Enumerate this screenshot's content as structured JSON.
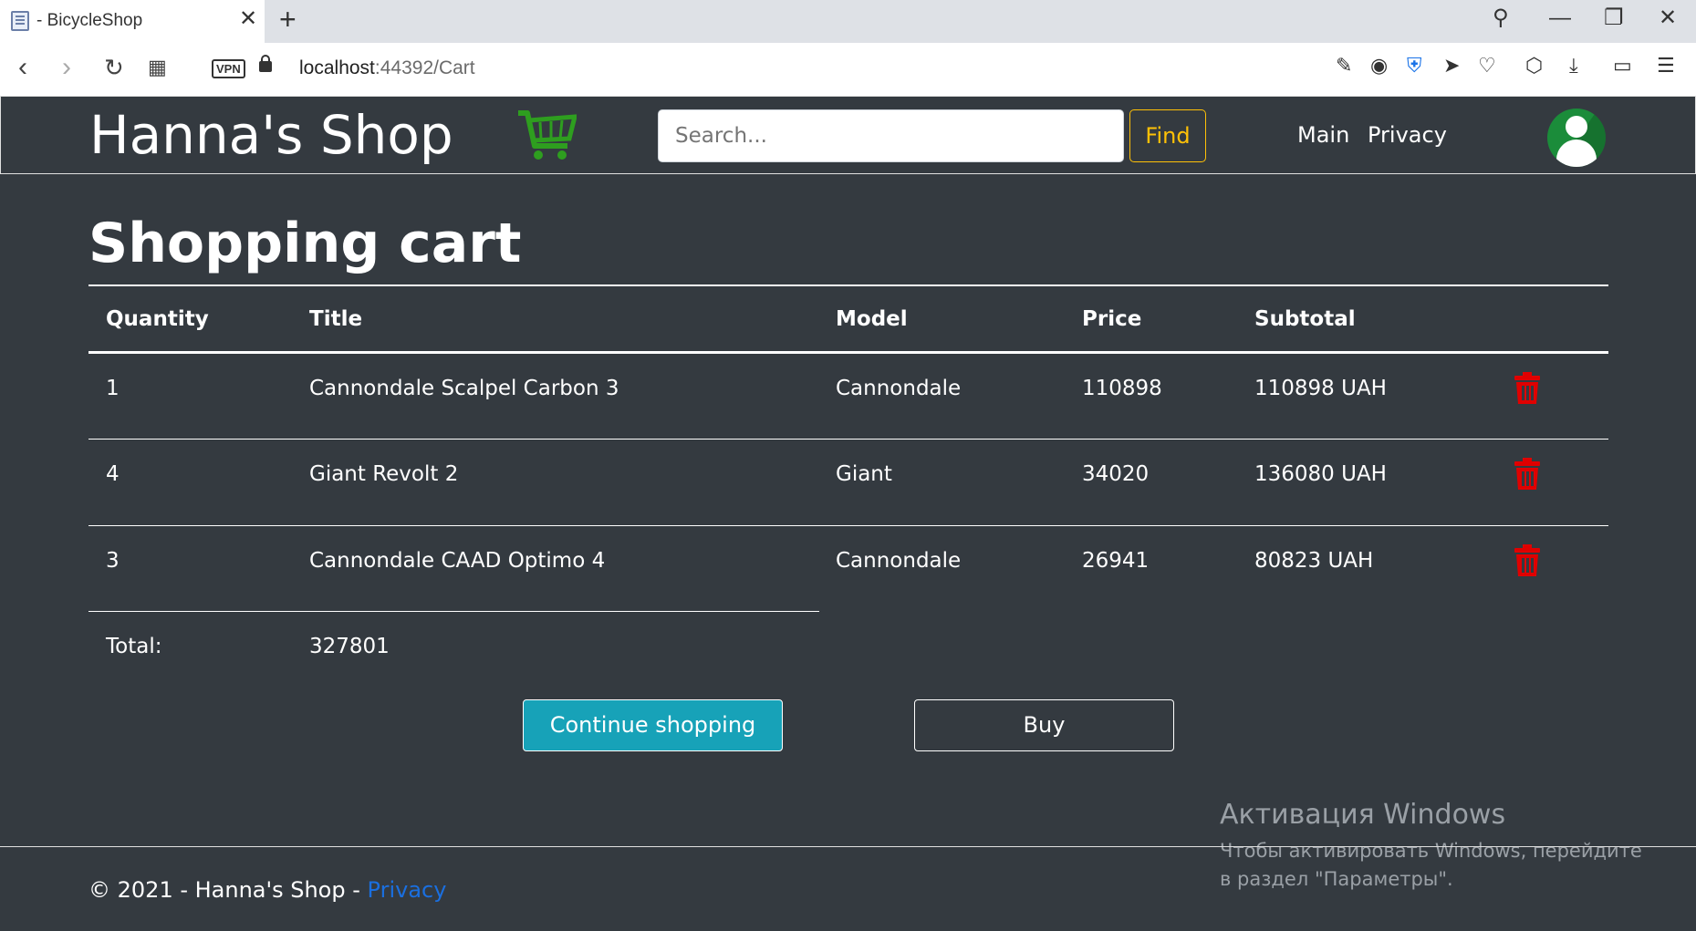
{
  "browser": {
    "tab_title": "- BicycleShop",
    "url_host": "localhost",
    "url_rest": ":44392/Cart",
    "vpn_label": "VPN"
  },
  "header": {
    "brand": "Hanna's Shop",
    "search_placeholder": "Search...",
    "find_label": "Find",
    "nav": [
      "Main",
      "Privacy"
    ]
  },
  "page": {
    "title": "Shopping cart",
    "columns": [
      "Quantity",
      "Title",
      "Model",
      "Price",
      "Subtotal"
    ],
    "rows": [
      {
        "quantity": "1",
        "title": "Cannondale Scalpel Carbon 3",
        "model": "Cannondale",
        "price": "110898",
        "subtotal": "110898 UAH"
      },
      {
        "quantity": "4",
        "title": "Giant Revolt 2",
        "model": "Giant",
        "price": "34020",
        "subtotal": "136080 UAH"
      },
      {
        "quantity": "3",
        "title": "Cannondale CAAD Optimo 4",
        "model": "Cannondale",
        "price": "26941",
        "subtotal": "80823 UAH"
      }
    ],
    "total_label": "Total:",
    "total_value": "327801",
    "continue_label": "Continue shopping",
    "buy_label": "Buy"
  },
  "watermark": {
    "title": "Активация Windows",
    "text": "Чтобы активировать Windows, перейдите в раздел \"Параметры\"."
  },
  "footer": {
    "text": "© 2021 - Hanna's Shop - ",
    "privacy_link": "Privacy"
  },
  "colors": {
    "background": "#343a40",
    "find_accent": "#ffc107",
    "continue_button": "#17a2b8",
    "delete_icon": "#e00000",
    "cart_icon": "#2e9e1f",
    "footer_link": "#1a6fe0"
  }
}
